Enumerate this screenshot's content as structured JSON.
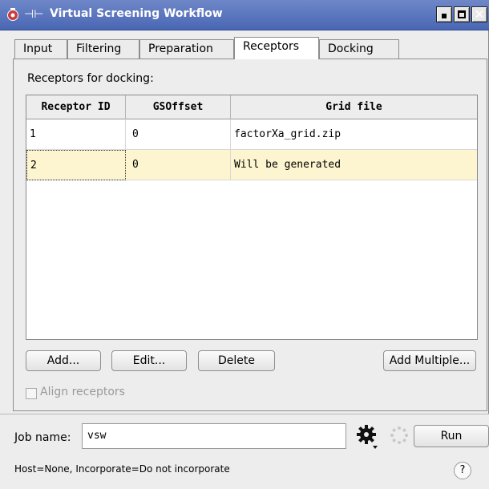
{
  "window": {
    "title": "Virtual Screening Workflow"
  },
  "tabs": [
    {
      "label": "Input"
    },
    {
      "label": "Filtering"
    },
    {
      "label": "Preparation"
    },
    {
      "label": "Receptors",
      "active": true
    },
    {
      "label": "Docking"
    }
  ],
  "receptors": {
    "section_label": "Receptors for docking:",
    "columns": [
      "Receptor ID",
      "GSOffset",
      "Grid file"
    ],
    "rows": [
      {
        "id": "1",
        "gsoffset": "0",
        "grid_file": "factorXa_grid.zip",
        "selected": false
      },
      {
        "id": "2",
        "gsoffset": "0",
        "grid_file": "Will be generated",
        "selected": true
      }
    ],
    "buttons": {
      "add": "Add...",
      "edit": "Edit...",
      "delete": "Delete",
      "add_multiple": "Add Multiple..."
    },
    "align_label": "Align receptors",
    "align_checked": false,
    "align_enabled": false
  },
  "job": {
    "label": "Job name:",
    "value": "vsw",
    "run_label": "Run",
    "status": "Host=None, Incorporate=Do not incorporate",
    "help_glyph": "?"
  },
  "colors": {
    "titlebar": "#5a74be",
    "selected_row": "#fdf5cf"
  }
}
